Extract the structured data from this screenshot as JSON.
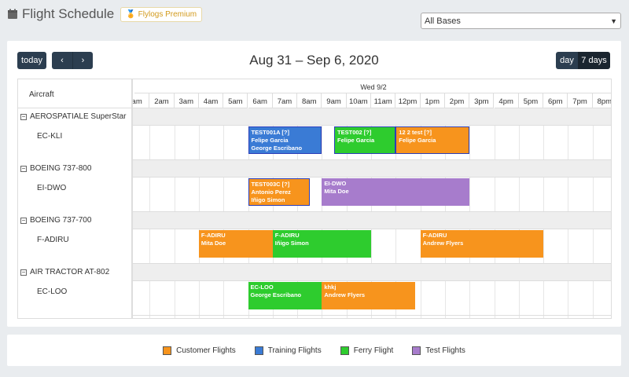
{
  "page": {
    "title": "Flight Schedule",
    "premium_label": "Flylogs Premium",
    "icons": {
      "calendar": "calendar-icon",
      "premium": "medal-icon"
    }
  },
  "bases": {
    "selected": "All Bases"
  },
  "toolbar": {
    "today": "today",
    "prev": "‹",
    "next": "›",
    "range_title": "Aug 31 – Sep 6, 2020",
    "day": "day",
    "week": "7 days"
  },
  "grid": {
    "resource_header": "Aircraft",
    "day_label": "Wed 9/2",
    "hours": [
      "am",
      "2am",
      "3am",
      "4am",
      "5am",
      "6am",
      "7am",
      "8am",
      "9am",
      "10am",
      "11am",
      "12pm",
      "1pm",
      "2pm",
      "3pm",
      "4pm",
      "5pm",
      "6pm",
      "7pm",
      "8pm"
    ],
    "groups": [
      {
        "name": "AEROSPATIALE SuperStar",
        "aircraft": "EC-KLI"
      },
      {
        "name": "BOEING 737-800",
        "aircraft": "EI-DWO"
      },
      {
        "name": "BOEING 737-700",
        "aircraft": "F-ADIRU"
      },
      {
        "name": "AIR TRACTOR AT-802",
        "aircraft": "EC-LOO"
      }
    ]
  },
  "colors": {
    "customer": "#f7941d",
    "training": "#3a7bd5",
    "ferry": "#2ecc2e",
    "test": "#a77ccc",
    "selected_border": "#2a3db8"
  },
  "events": [
    {
      "row": 0,
      "start": 6,
      "end": 9,
      "kind": "training",
      "selected": true,
      "l1": "TEST001A [?]",
      "l2": "Felipe Garcia",
      "l3": "George Escribano"
    },
    {
      "row": 0,
      "start": 9.5,
      "end": 12,
      "kind": "ferry",
      "selected": true,
      "l1": "TEST002 [?]",
      "l2": "Felipe Garcia",
      "l3": ""
    },
    {
      "row": 0,
      "start": 12,
      "end": 15,
      "kind": "customer",
      "selected": true,
      "l1": "12 2 test [?]",
      "l2": "Felipe Garcia",
      "l3": ""
    },
    {
      "row": 1,
      "start": 6,
      "end": 8.5,
      "kind": "customer",
      "selected": true,
      "l1": "TEST003C [?]",
      "l2": "Antonio Perez",
      "l3": "Iñigo Simon"
    },
    {
      "row": 1,
      "start": 9,
      "end": 15,
      "kind": "test",
      "selected": false,
      "l1": "EI-DWO",
      "l2": "Mita Doe",
      "l3": ""
    },
    {
      "row": 2,
      "start": 4,
      "end": 7,
      "kind": "customer",
      "selected": false,
      "l1": "F-ADIRU",
      "l2": "Mita Doe",
      "l3": ""
    },
    {
      "row": 2,
      "start": 7,
      "end": 11,
      "kind": "ferry",
      "selected": false,
      "l1": "F-ADIRU",
      "l2": "Iñigo Simon",
      "l3": ""
    },
    {
      "row": 2,
      "start": 13,
      "end": 18,
      "kind": "customer",
      "selected": false,
      "l1": "F-ADIRU",
      "l2": "Andrew Flyers",
      "l3": ""
    },
    {
      "row": 3,
      "start": 6,
      "end": 9,
      "kind": "ferry",
      "selected": false,
      "l1": "EC-LOO",
      "l2": "George Escribano",
      "l3": ""
    },
    {
      "row": 3,
      "start": 9,
      "end": 12.8,
      "kind": "customer",
      "selected": false,
      "l1": "khkj",
      "l2": "Andrew Flyers",
      "l3": ""
    }
  ],
  "legend": [
    {
      "label": "Customer Flights",
      "color": "#f7941d"
    },
    {
      "label": "Training Flights",
      "color": "#3a7bd5"
    },
    {
      "label": "Ferry Flight",
      "color": "#2ecc2e"
    },
    {
      "label": "Test Flights",
      "color": "#a77ccc"
    }
  ]
}
